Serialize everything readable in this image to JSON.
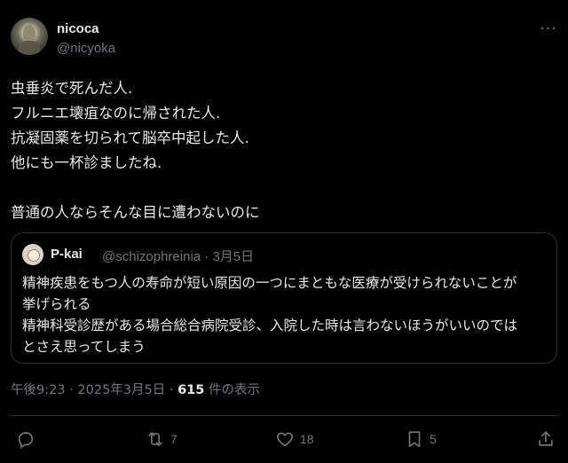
{
  "author": {
    "name": "nicoca",
    "handle": "@nicyoka"
  },
  "more_icon": "more-horizontal-icon",
  "tweet": {
    "lines": [
      "虫垂炎で死んだ人.",
      "フルニエ壊疽なのに帰された人.",
      "抗凝固薬を切られて脳卒中起した人.",
      "他にも一杯診ましたね.",
      "",
      "普通の人ならそんな目に遭わないのに"
    ]
  },
  "quote": {
    "name": "P-kai",
    "handle": "@schizophreinia",
    "separator": "·",
    "date": "3月5日",
    "lines": [
      "精神疾患をもつ人の寿命が短い原因の一つにまともな医療が受けられないことが",
      "挙げられる",
      "精神科受診歴がある場合総合病院受診、入院した時は言わないほうがいいのでは",
      "とさえ思ってしまう"
    ]
  },
  "meta": {
    "time": "午後9:23",
    "separator": "·",
    "date": "2025年3月5日",
    "views_count": "615",
    "views_label": "件の表示"
  },
  "actions": {
    "reply": {
      "icon": "reply-icon",
      "count": ""
    },
    "retweet": {
      "icon": "retweet-icon",
      "count": "7"
    },
    "like": {
      "icon": "heart-icon",
      "count": "18"
    },
    "bookmark": {
      "icon": "bookmark-icon",
      "count": "5"
    },
    "share": {
      "icon": "share-icon",
      "count": ""
    }
  },
  "colors": {
    "background": "#000000",
    "text": "#e7e9ea",
    "muted": "#71767b",
    "border": "#2f3336"
  }
}
